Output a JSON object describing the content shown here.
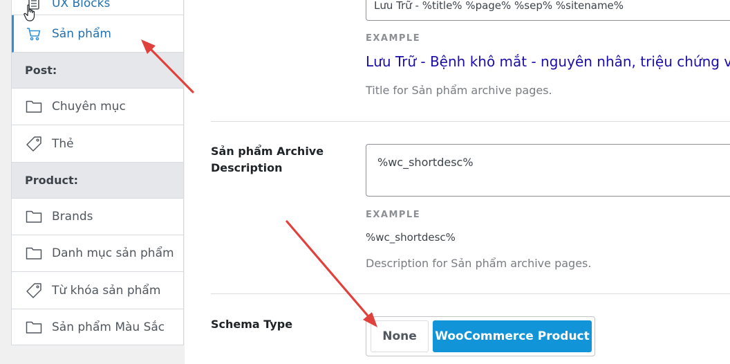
{
  "sidebar": {
    "top_partial_label": "UX Blocks",
    "active_item": "Sản phẩm",
    "post_header": "Post:",
    "post_items": [
      "Chuyên mục",
      "Thẻ"
    ],
    "product_header": "Product:",
    "product_items": [
      "Brands",
      "Danh mục sản phẩm",
      "Từ khóa sản phẩm",
      "Sản phẩm Màu Sắc"
    ]
  },
  "archive_title": {
    "value": "Lưu Trữ - %title% %page% %sep% %sitename%",
    "example_label": "EXAMPLE",
    "example_value": "Lưu Trữ - Bệnh khô mắt - nguyên nhân, triệu chứng v",
    "help": "Title for Sản phẩm archive pages."
  },
  "archive_description": {
    "label": "Sản phẩm Archive Description",
    "value": "%wc_shortdesc%",
    "example_label": "EXAMPLE",
    "example_value": "%wc_shortdesc%",
    "help": "Description for Sản phẩm archive pages."
  },
  "schema_type": {
    "label": "Schema Type",
    "options": [
      "None",
      "WooCommerce Product"
    ],
    "selected": "WooCommerce Product"
  },
  "colors": {
    "accent": "#2271b1",
    "selected_button": "#1195d8",
    "arrow": "#e0413c"
  }
}
